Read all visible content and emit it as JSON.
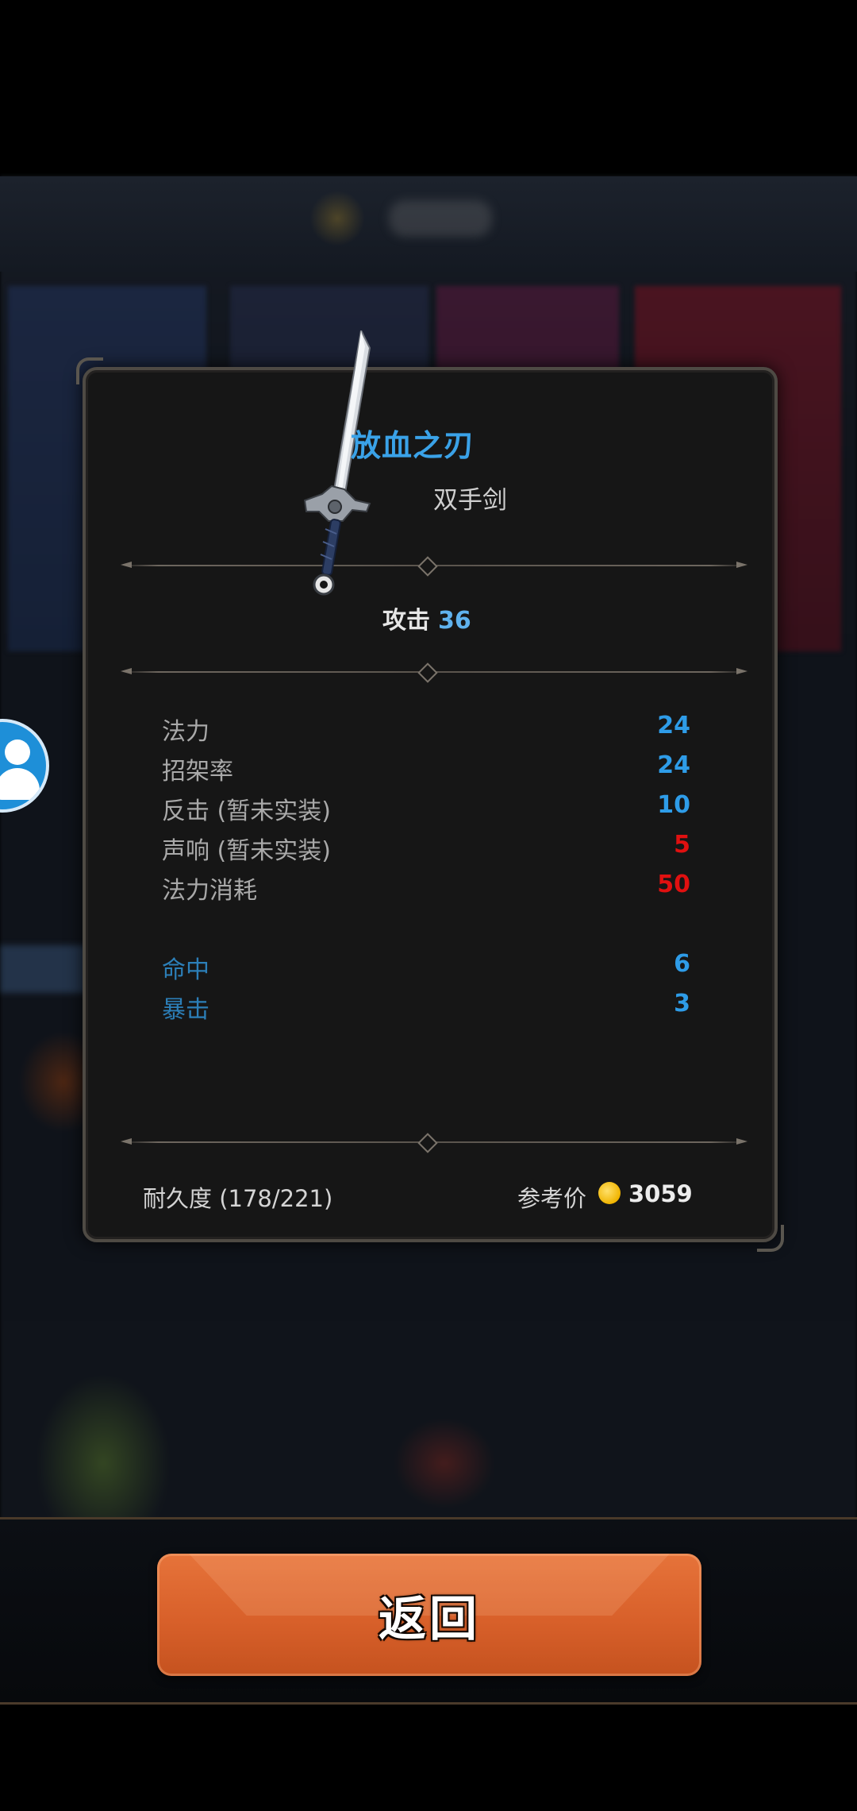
{
  "item": {
    "name": "放血之刃",
    "type": "双手剑",
    "attack_label": "攻击",
    "attack_value": "36"
  },
  "stats": [
    {
      "label": "法力",
      "value": "24",
      "color": "#2e9ce8"
    },
    {
      "label": "招架率",
      "value": "24",
      "color": "#2e9ce8"
    },
    {
      "label": "反击 (暂未实装)",
      "value": "10",
      "color": "#2e9ce8"
    },
    {
      "label": "声响 (暂未实装)",
      "value": "5",
      "color": "#e01010"
    },
    {
      "label": "法力消耗",
      "value": "50",
      "color": "#e01010"
    }
  ],
  "bonus_stats": [
    {
      "label": "命中",
      "value": "6"
    },
    {
      "label": "暴击",
      "value": "3"
    }
  ],
  "footer": {
    "durability": "耐久度 (178/221)",
    "price_label": "参考价",
    "price_value": "3059"
  },
  "actions": {
    "back_label": "返回"
  },
  "icons": {
    "weapon": "two-handed-sword-icon",
    "coin": "gold-coin-icon",
    "avatar": "user-avatar-icon"
  },
  "colors": {
    "name_blue": "#3aa2e8",
    "value_blue": "#2e9ce8",
    "value_red": "#e01010",
    "button_orange": "#d8602a"
  }
}
